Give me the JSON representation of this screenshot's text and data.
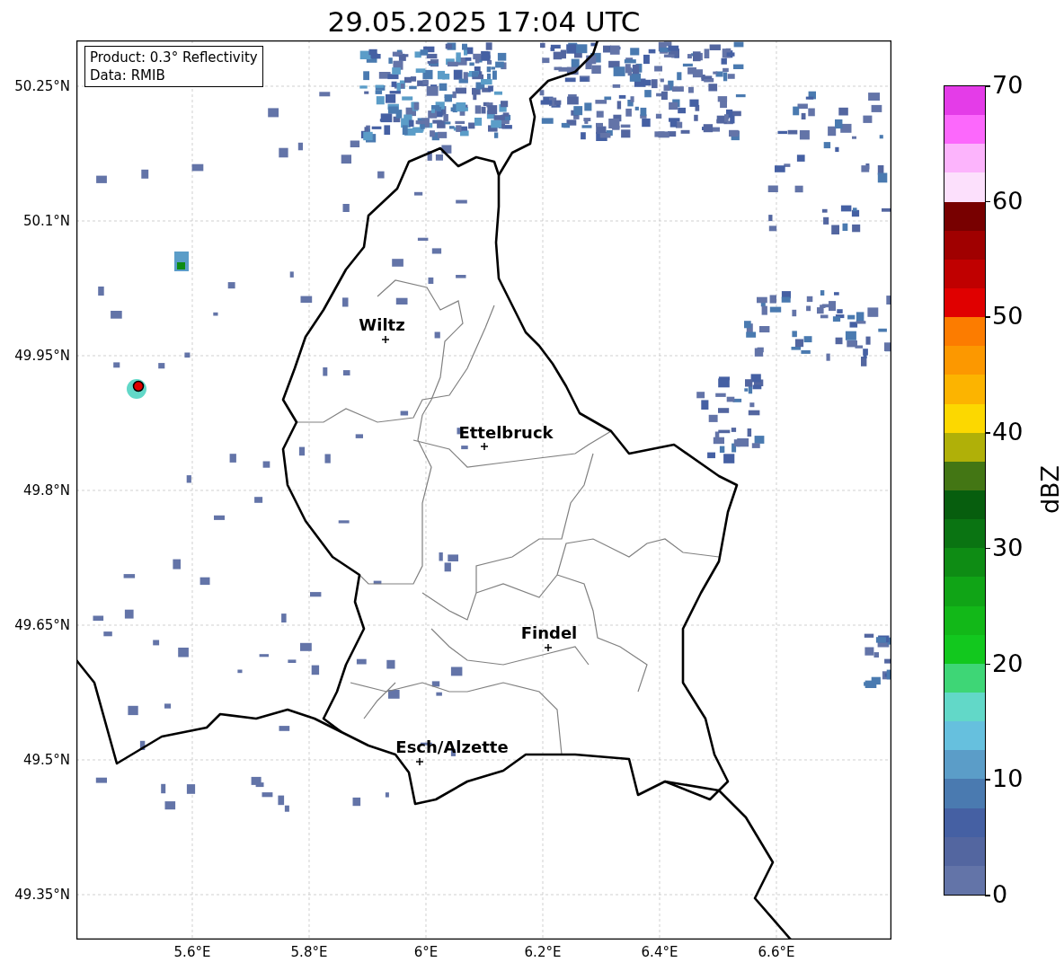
{
  "title": "29.05.2025 17:04 UTC",
  "info_box": [
    "Product: 0.3° Reflectivity",
    "Data: RMIB"
  ],
  "map": {
    "lat_ticks": [
      "50.25°N",
      "50.1°N",
      "49.95°N",
      "49.8°N",
      "49.65°N",
      "49.5°N",
      "49.35°N"
    ],
    "lon_ticks": [
      "5.6°E",
      "5.8°E",
      "6°E",
      "6.2°E",
      "6.4°E",
      "6.6°E"
    ],
    "cities": [
      {
        "name": "Wiltz"
      },
      {
        "name": "Ettelbruck"
      },
      {
        "name": "Findel"
      },
      {
        "name": "Esch/Alzette"
      }
    ]
  },
  "colorbar": {
    "label": "dBZ",
    "ticks": [
      "70",
      "60",
      "50",
      "40",
      "30",
      "20",
      "10",
      "0"
    ],
    "bands": [
      {
        "color": "#e43ce8"
      },
      {
        "color": "#fc68fc"
      },
      {
        "color": "#fcb4fc"
      },
      {
        "color": "#fce0fc"
      },
      {
        "color": "#780000"
      },
      {
        "color": "#a00000"
      },
      {
        "color": "#c00000"
      },
      {
        "color": "#e00000"
      },
      {
        "color": "#fc7c00"
      },
      {
        "color": "#fc9800"
      },
      {
        "color": "#fcb400"
      },
      {
        "color": "#fcd800"
      },
      {
        "color": "#b0b008"
      },
      {
        "color": "#437614"
      },
      {
        "color": "#075e0e"
      },
      {
        "color": "#0a7412"
      },
      {
        "color": "#0e8c14"
      },
      {
        "color": "#10a416"
      },
      {
        "color": "#12b818"
      },
      {
        "color": "#12c81e"
      },
      {
        "color": "#3ed676"
      },
      {
        "color": "#62d8c8"
      },
      {
        "color": "#66c0de"
      },
      {
        "color": "#5b9dc8"
      },
      {
        "color": "#4a7ab0"
      },
      {
        "color": "#4560a3"
      },
      {
        "color": "#5366a0"
      },
      {
        "color": "#6374a8"
      }
    ]
  }
}
